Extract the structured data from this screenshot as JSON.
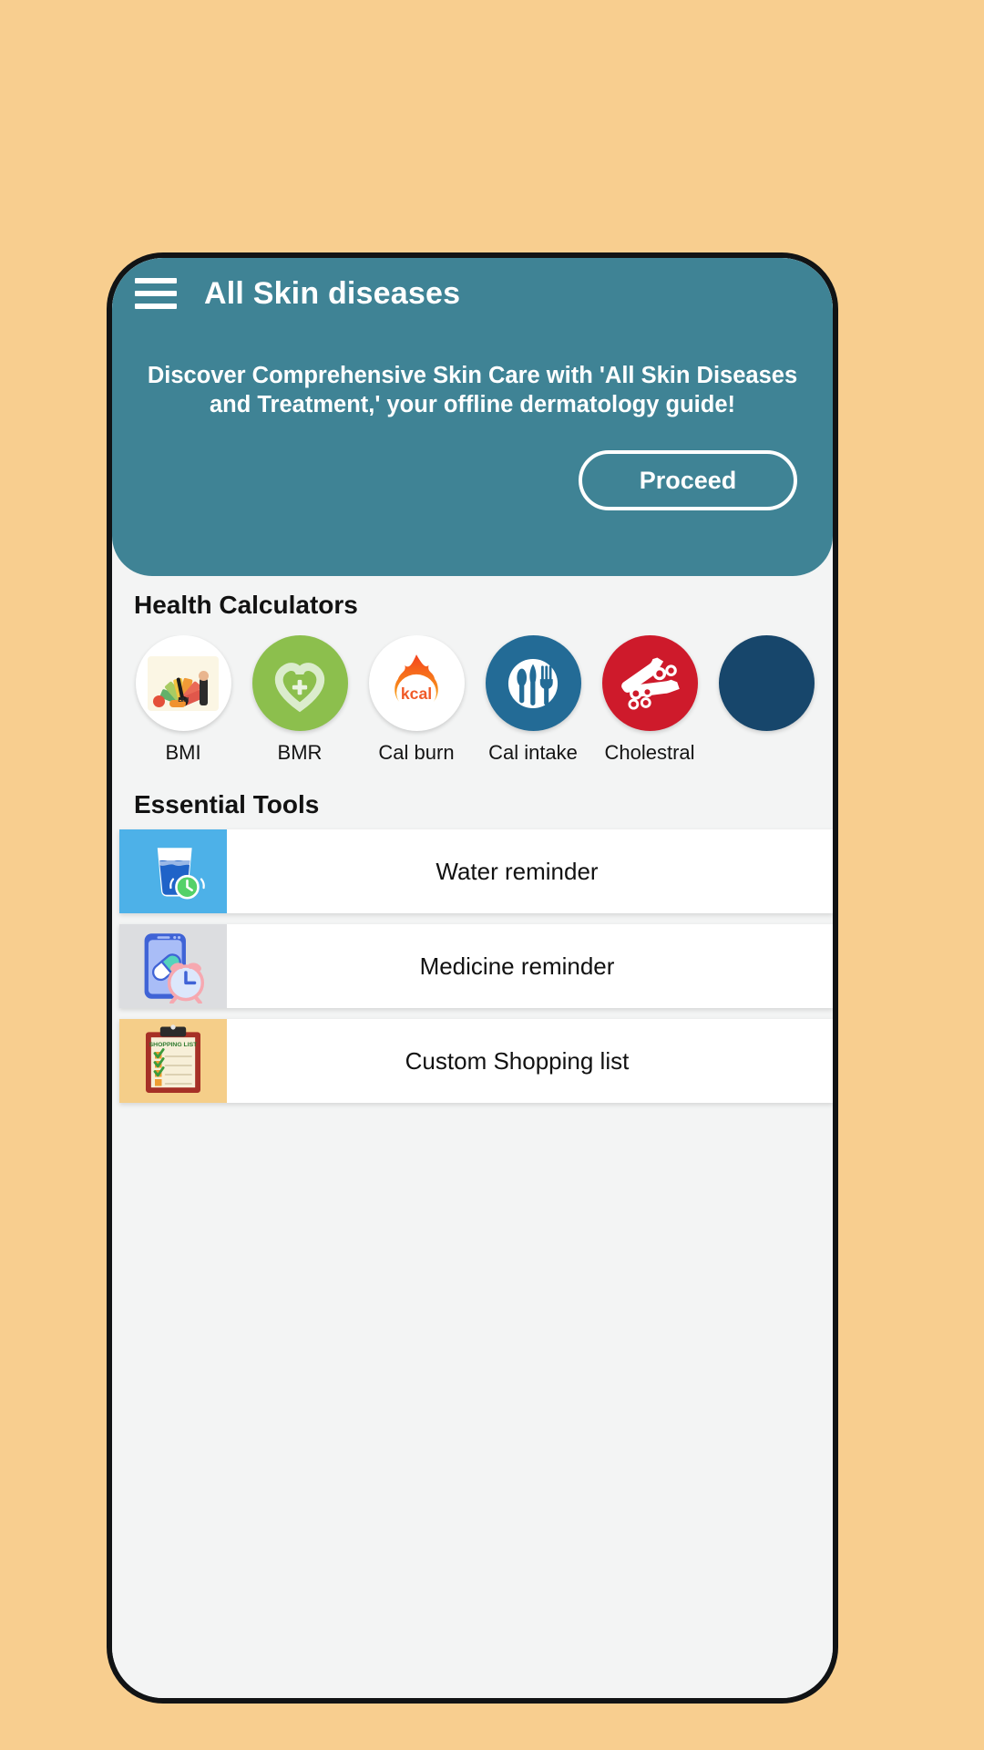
{
  "theme": {
    "page_background": "#F8CE8F",
    "header_teal": "#3F8395",
    "screen_background": "#F3F4F4",
    "card_white": "#FFFFFF",
    "text_dark": "#121212",
    "text_on_teal": "#FFFFFF"
  },
  "header": {
    "menu_icon": "hamburger-menu-icon",
    "title": "All Skin diseases",
    "description": "Discover Comprehensive Skin Care with 'All Skin Diseases and Treatment,' your offline dermatology guide!",
    "proceed_label": "Proceed"
  },
  "health_calculators": {
    "section_title": "Health Calculators",
    "items": [
      {
        "label": "BMI",
        "icon": "bmi-gauge-icon",
        "circle_color": "#FFFFFF"
      },
      {
        "label": "BMR",
        "icon": "heart-plus-icon",
        "circle_color": "#8CBF4D"
      },
      {
        "label": "Cal burn",
        "icon": "kcal-flame-icon",
        "circle_color": "#FFFFFF"
      },
      {
        "label": "Cal intake",
        "icon": "cutlery-plate-icon",
        "circle_color": "#236B96"
      },
      {
        "label": "Cholestral",
        "icon": "bottles-icon",
        "circle_color": "#CE1A2B"
      },
      {
        "label": "",
        "icon": "partial-next-icon",
        "circle_color": "#17466B"
      }
    ]
  },
  "essential_tools": {
    "section_title": "Essential Tools",
    "items": [
      {
        "label": "Water reminder",
        "icon": "water-glass-clock-icon",
        "thumb_color": "#4DB1E8"
      },
      {
        "label": "Medicine reminder",
        "icon": "phone-pill-alarm-icon",
        "thumb_color": "#DCDDE0"
      },
      {
        "label": "Custom Shopping list",
        "icon": "shopping-list-clipboard-icon",
        "thumb_color": "#F5CE89",
        "clipboard_text": "SHOPPING LIST"
      }
    ]
  }
}
